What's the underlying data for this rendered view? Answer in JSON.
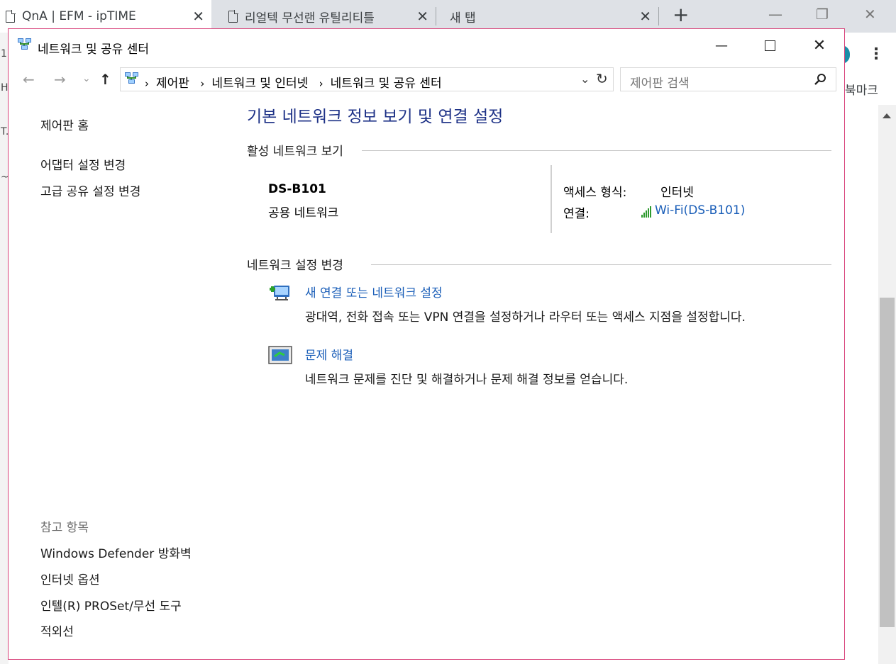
{
  "browser": {
    "tabs": [
      {
        "title": "QnA | EFM - ipTIME"
      },
      {
        "title": "리얼텍 무선랜 유틸리티틀"
      },
      {
        "title": "새 탭"
      }
    ],
    "new_tab_glyph": "+",
    "close_glyph": "✕",
    "bookmark_text": "북마크",
    "menu_glyph": "⋮",
    "left_edge_glyphs": [
      "1",
      "H",
      "T.",
      "~"
    ]
  },
  "window": {
    "title": "네트워크 및 공유 센터",
    "controls": {
      "minimize": "—",
      "close": "✕"
    }
  },
  "address": {
    "nav": {
      "back": "←",
      "forward": "→",
      "recent": "⌄",
      "up": "↑"
    },
    "breadcrumbs": [
      "제어판",
      "네트워크 및 인터넷",
      "네트워크 및 공유 센터"
    ],
    "breadcrumb_sep": "›",
    "dropdown_glyph": "⌄",
    "refresh_glyph": "↻",
    "search_placeholder": "제어판 검색"
  },
  "sidebar": {
    "home": "제어판 홈",
    "links": [
      "어댑터 설정 변경",
      "고급 공유 설정 변경"
    ],
    "see_also_heading": "참고 항목",
    "see_also": [
      "Windows Defender 방화벽",
      "인터넷 옵션",
      "인텔(R) PROSet/무선 도구",
      "적외선"
    ]
  },
  "main": {
    "heading": "기본 네트워크 정보 보기 및 연결 설정",
    "active_section": "활성 네트워크 보기",
    "network": {
      "name": "DS-B101",
      "type": "공용 네트워크",
      "access_label": "액세스 형식:",
      "access_value": "인터넷",
      "connection_label": "연결:",
      "connection_value": "Wi-Fi(DS-B101)"
    },
    "change_section": "네트워크 설정 변경",
    "tasks": [
      {
        "title": "새 연결 또는 네트워크 설정",
        "desc": "광대역, 전화 접속 또는 VPN 연결을 설정하거나 라우터 또는 액세스 지점을 설정합니다."
      },
      {
        "title": "문제 해결",
        "desc": "네트워크 문제를 진단 및 해결하거나 문제 해결 정보를 얻습니다."
      }
    ]
  },
  "colors": {
    "window_border": "#d8427a",
    "heading": "#1e3287",
    "link": "#1a5eb8",
    "wifi_bars": "#2e9a2e"
  },
  "icons": [
    "document-icon",
    "network-center-icon",
    "search-icon",
    "wifi-signal-icon",
    "new-connection-icon",
    "troubleshoot-icon"
  ]
}
